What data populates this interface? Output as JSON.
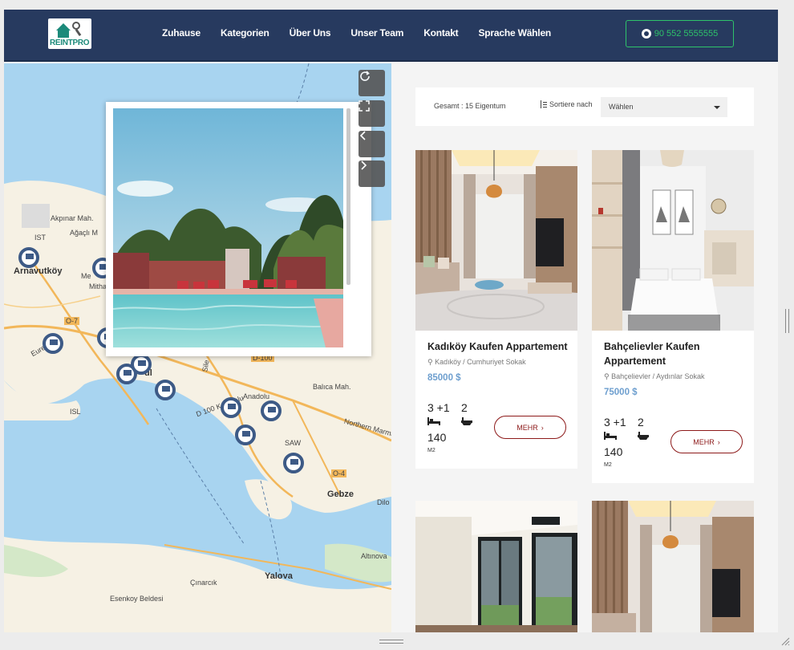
{
  "nav": {
    "logo": "REINTPRO",
    "links": [
      "Zuhause",
      "Kategorien",
      "Über Uns",
      "Unser Team",
      "Kontakt",
      "Sprache Wählen"
    ],
    "phone": "90 552 5555555"
  },
  "map": {
    "labels": [
      "Akpınar Mah.",
      "Ağaçlı M",
      "IST",
      "Arnavutköy",
      "Me",
      "Mitha",
      "Balıca Mah.",
      "Anadolu",
      "D 100 Karayolu",
      "SAW",
      "Northern Marmara",
      "Gebze",
      "Dilo",
      "Altınova",
      "Yalova",
      "Çınarcık",
      "Esenkoy Beldesi",
      "ISL",
      "O-4",
      "O-7",
      "D-100",
      "Eure",
      "ul",
      "Sile"
    ],
    "controls": [
      "refresh-icon",
      "fullscreen-icon",
      "prev-icon",
      "next-icon"
    ]
  },
  "listing": {
    "total": "Gesamt : 15 Eigentum",
    "sort_label": "Sortiere nach",
    "sort_value": "Wählen"
  },
  "cards": [
    {
      "title": "Kadıköy Kaufen Appartement",
      "address": "Kadıköy / Cumhuriyet Sokak",
      "price": "85000 $",
      "rooms": "3 +1",
      "baths": "2",
      "area": "140",
      "area_unit": "M2",
      "button": "MEHR"
    },
    {
      "title": "Bahçelievler Kaufen Appartement",
      "address": "Bahçelievler / Aydınlar Sokak",
      "price": "75000 $",
      "rooms": "3 +1",
      "baths": "2",
      "area": "140",
      "area_unit": "M2",
      "button": "MEHR"
    }
  ],
  "colors": {
    "navbar": "#273a5f",
    "phone_accent": "#2ec36a",
    "price": "#6e9fcf",
    "button_border": "#8d1a1a",
    "map_pin": "#3d5a86",
    "sea": "#a8d4f0"
  }
}
